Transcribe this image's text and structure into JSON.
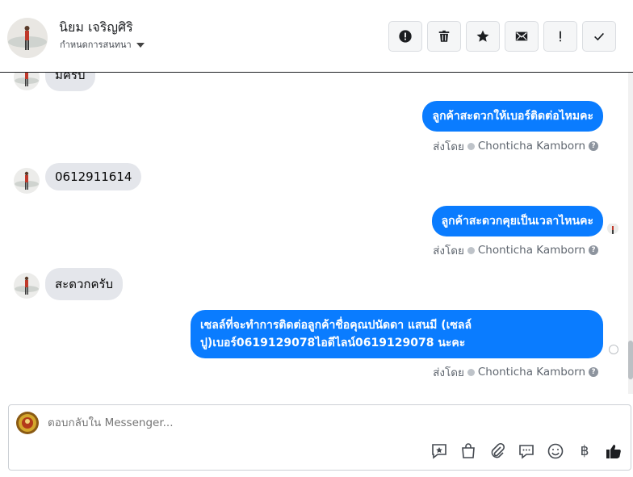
{
  "header": {
    "contact_name": "นิยม เจริญศิริ",
    "assign_label": "กำหนดการสนทนา",
    "actions": [
      "alert-circle",
      "trash",
      "star",
      "envelope",
      "exclamation",
      "check"
    ]
  },
  "thread": {
    "messages": [
      {
        "from": "contact",
        "text": "มีครับ"
      },
      {
        "from": "page",
        "text": "ลูกค้าสะดวกให้เบอร์ติดต่อไหมคะ",
        "sent_by_label": "ส่งโดย",
        "sender": "Chonticha Kamborn"
      },
      {
        "from": "contact",
        "text": "0612911614"
      },
      {
        "from": "page",
        "text": "ลูกค้าสะดวกคุยเป็นเวลาไหนคะ",
        "sent_by_label": "ส่งโดย",
        "sender": "Chonticha Kamborn"
      },
      {
        "from": "contact",
        "text": "สะดวกครับ"
      },
      {
        "from": "page",
        "text": "เซลล์ที่จะทำการติดต่อลูกค้าชื่อคุณปนัดดา แสนมี (เซลล์ ปู)เบอร์0619129078ไอดีไลน์0619129078 นะคะ",
        "sent_by_label": "ส่งโดย",
        "sender": "Chonticha Kamborn"
      }
    ]
  },
  "composer": {
    "placeholder": "ตอบกลับใน Messenger...",
    "tools": [
      "saved-reply-icon",
      "shopping-bag-icon",
      "paperclip-icon",
      "chat-bubble-icon",
      "emoji-icon",
      "baht-icon",
      "thumbs-up-icon"
    ],
    "baht_symbol": "฿"
  },
  "colors": {
    "outgoing_bubble": "#0a7cff",
    "incoming_bubble": "#e4e6eb",
    "like_icon": "#1c1e21"
  }
}
